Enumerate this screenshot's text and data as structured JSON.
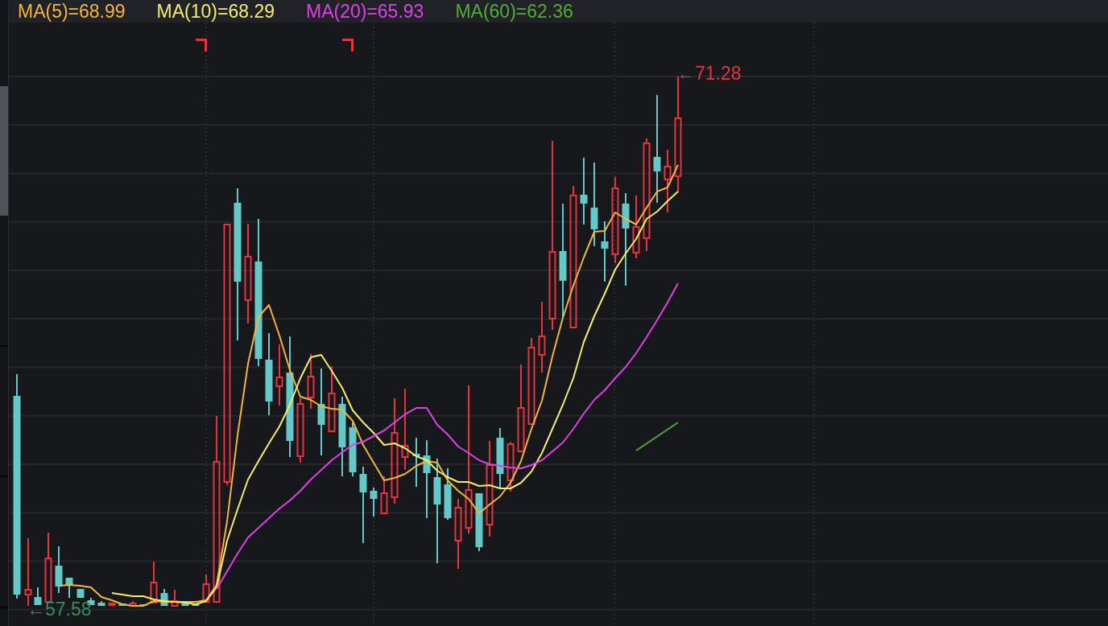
{
  "legend": [
    {
      "label": "MA(5)=68.99",
      "color": "#f5b43c"
    },
    {
      "label": "MA(10)=68.29",
      "color": "#f6ee6a"
    },
    {
      "label": "MA(20)=65.93",
      "color": "#e040e8"
    },
    {
      "label": "MA(60)=62.36",
      "color": "#4fae33"
    }
  ],
  "price_markers": {
    "high": "←71.28",
    "low": "←57.58"
  }
}
